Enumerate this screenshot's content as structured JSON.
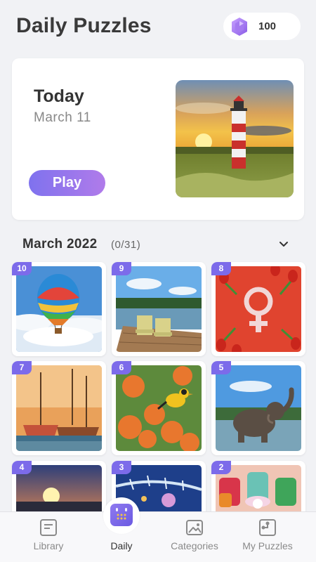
{
  "header": {
    "title": "Daily Puzzles",
    "gems": "100"
  },
  "today": {
    "label": "Today",
    "date": "March  11",
    "play_label": "Play"
  },
  "month": {
    "label": "March  2022",
    "progress": "(0/31)"
  },
  "puzzles": [
    {
      "day": "10",
      "scene": "hot-air-balloon"
    },
    {
      "day": "9",
      "scene": "lakeside-chairs"
    },
    {
      "day": "8",
      "scene": "tulips-female-symbol"
    },
    {
      "day": "7",
      "scene": "sailing-ships"
    },
    {
      "day": "6",
      "scene": "bird-oranges"
    },
    {
      "day": "5",
      "scene": "elephant"
    },
    {
      "day": "4",
      "scene": "sunset"
    },
    {
      "day": "3",
      "scene": "frosty-branch"
    },
    {
      "day": "2",
      "scene": "sewing-supplies"
    }
  ],
  "nav": {
    "library": "Library",
    "daily": "Daily",
    "categories": "Categories",
    "my_puzzles": "My Puzzles"
  },
  "colors": {
    "accent": "#7c6bea",
    "play_gradient_start": "#7f72ee",
    "play_gradient_end": "#b07bea"
  }
}
